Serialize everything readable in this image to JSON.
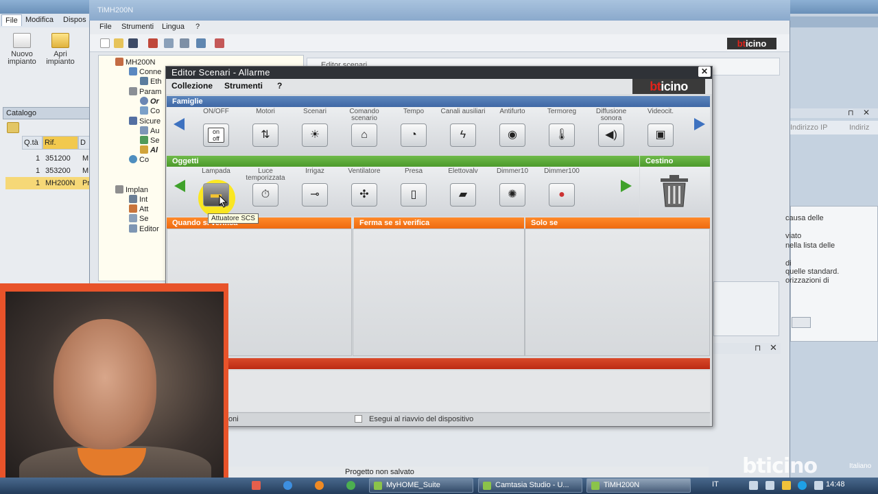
{
  "left_app": {
    "menu": [
      "File",
      "Modifica",
      "Dispos"
    ],
    "ribbon": [
      {
        "label": "Nuovo impianto"
      },
      {
        "label": "Apri impianto"
      }
    ],
    "catalog": {
      "title": "Catalogo",
      "columns": [
        "Q.tà",
        "Rif.",
        "D"
      ],
      "rows": [
        {
          "qty": "1",
          "ref": "351200",
          "d": "M"
        },
        {
          "qty": "1",
          "ref": "353200",
          "d": "M"
        },
        {
          "qty": "1",
          "ref": "MH200N",
          "d": "Pr"
        }
      ]
    }
  },
  "tim": {
    "title": "TiMH200N",
    "menu": [
      "File",
      "Strumenti",
      "Lingua",
      "?"
    ],
    "tree": {
      "root": "MH200N",
      "items": [
        "Conne",
        "Eth",
        "Param",
        "Or",
        "Co",
        "Sicure",
        "Au",
        "Se",
        "Al",
        "Co",
        "Implan",
        "Int",
        "Att",
        "Se",
        "Editor"
      ]
    },
    "bg_editor_tab": "Editor scenari",
    "status": "Progetto non salvato"
  },
  "dialog": {
    "title": "Editor Scenari - Allarme",
    "menu": [
      "Collezione",
      "Strumenti",
      "?"
    ],
    "brand": {
      "red": "bt",
      "white": "icino"
    },
    "famiglie": {
      "header": "Famiglie",
      "items": [
        {
          "label": "ON/OFF",
          "icon": "on-off-icon",
          "glyph_text": "on off"
        },
        {
          "label": "Motori",
          "icon": "motor-icon"
        },
        {
          "label": "Scenari",
          "icon": "scenario-icon"
        },
        {
          "label": "Comando scenario",
          "icon": "house-scenario-icon"
        },
        {
          "label": "Tempo",
          "icon": "clock-icon"
        },
        {
          "label": "Canali ausiliari",
          "icon": "lightning-icon"
        },
        {
          "label": "Antifurto",
          "icon": "alarm-icon"
        },
        {
          "label": "Termoreg",
          "icon": "thermometer-icon"
        },
        {
          "label": "Diffusione sonora",
          "icon": "speaker-icon"
        },
        {
          "label": "Videocit.",
          "icon": "videophone-icon"
        }
      ]
    },
    "oggetti": {
      "header": "Oggetti",
      "items": [
        {
          "label": "Lampada",
          "icon": "lamp-icon"
        },
        {
          "label": "Luce temporizzata",
          "icon": "timed-light-icon"
        },
        {
          "label": "Irrigaz",
          "icon": "irrigation-icon"
        },
        {
          "label": "Ventilatore",
          "icon": "fan-icon"
        },
        {
          "label": "Presa",
          "icon": "socket-icon"
        },
        {
          "label": "Elettovalv",
          "icon": "valve-icon"
        },
        {
          "label": "Dimmer10",
          "icon": "dimmer10-icon"
        },
        {
          "label": "Dimmer100",
          "icon": "dimmer100-icon"
        }
      ]
    },
    "cestino": {
      "header": "Cestino"
    },
    "tooltip": "Attuatore SCS",
    "columns": [
      {
        "header": "Quando si verifica"
      },
      {
        "header": "Ferma se si verifica"
      },
      {
        "header": "Solo se"
      }
    ],
    "footer": {
      "left": "oni",
      "checkbox": "Esegui al riavvio del dispositivo"
    }
  },
  "right_panel": {
    "lines": [
      "causa delle",
      "viato",
      "nella lista delle",
      "di",
      "quelle standard.",
      "orizzazioni di"
    ],
    "header_labels": [
      "Indirizzo IP",
      "Indiriz"
    ]
  },
  "taskbar": {
    "buttons": [
      "MyHOME_Suite",
      "Camtasia Studio - U...",
      "TiMH200N"
    ],
    "language": "IT",
    "clock": "14:48",
    "watermark": "bticino",
    "lang_label": "Italiano"
  },
  "colors": {
    "famiglie": "#3f68a5",
    "oggetti": "#4c9a2c",
    "columns": "#ef6a10",
    "brand_red": "#e2231a"
  }
}
